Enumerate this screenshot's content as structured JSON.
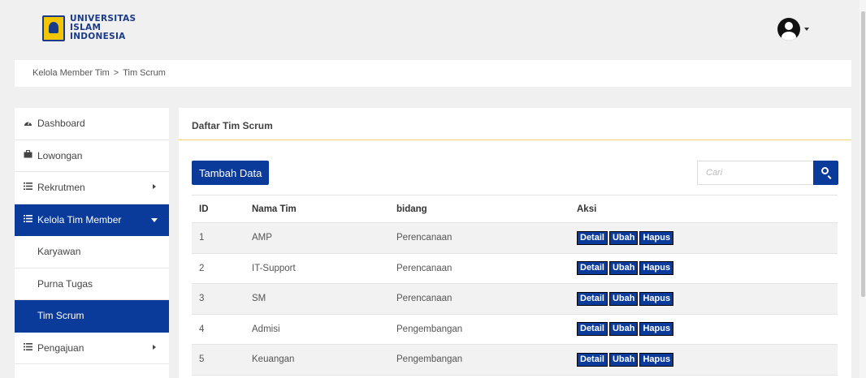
{
  "header": {
    "logo_lines": [
      "UNIVERSITAS",
      "ISLAM",
      "INDONESIA"
    ]
  },
  "breadcrumb": {
    "items": [
      "Kelola Member Tim",
      "Tim Scrum"
    ],
    "separator": ">"
  },
  "sidebar": {
    "items": [
      {
        "label": "Dashboard",
        "icon": "dashboard-icon"
      },
      {
        "label": "Lowongan",
        "icon": "briefcase-icon"
      },
      {
        "label": "Rekrutmen",
        "icon": "list-icon"
      },
      {
        "label": "Kelola Tim Member",
        "icon": "list-icon"
      },
      {
        "label": "Karyawan"
      },
      {
        "label": "Purna Tugas"
      },
      {
        "label": "Tim Scrum"
      },
      {
        "label": "Pengajuan",
        "icon": "list-icon"
      }
    ]
  },
  "panel": {
    "title": "Daftar Tim Scrum",
    "add_button": "Tambah Data",
    "search_placeholder": "Cari"
  },
  "table": {
    "headers": [
      "ID",
      "Nama Tim",
      "bidang",
      "Aksi"
    ],
    "rows": [
      {
        "id": "1",
        "nama": "AMP",
        "bidang": "Perencanaan"
      },
      {
        "id": "2",
        "nama": "IT-Support",
        "bidang": "Perencanaan"
      },
      {
        "id": "3",
        "nama": "SM",
        "bidang": "Perencanaan"
      },
      {
        "id": "4",
        "nama": "Admisi",
        "bidang": "Pengembangan"
      },
      {
        "id": "5",
        "nama": "Keuangan",
        "bidang": "Pengembangan"
      }
    ],
    "actions": [
      "Detail",
      "Ubah",
      "Hapus"
    ]
  },
  "colors": {
    "primary": "#0a3a9a",
    "header_underline": "#f3d36b",
    "logo_gold": "#f3c600"
  }
}
